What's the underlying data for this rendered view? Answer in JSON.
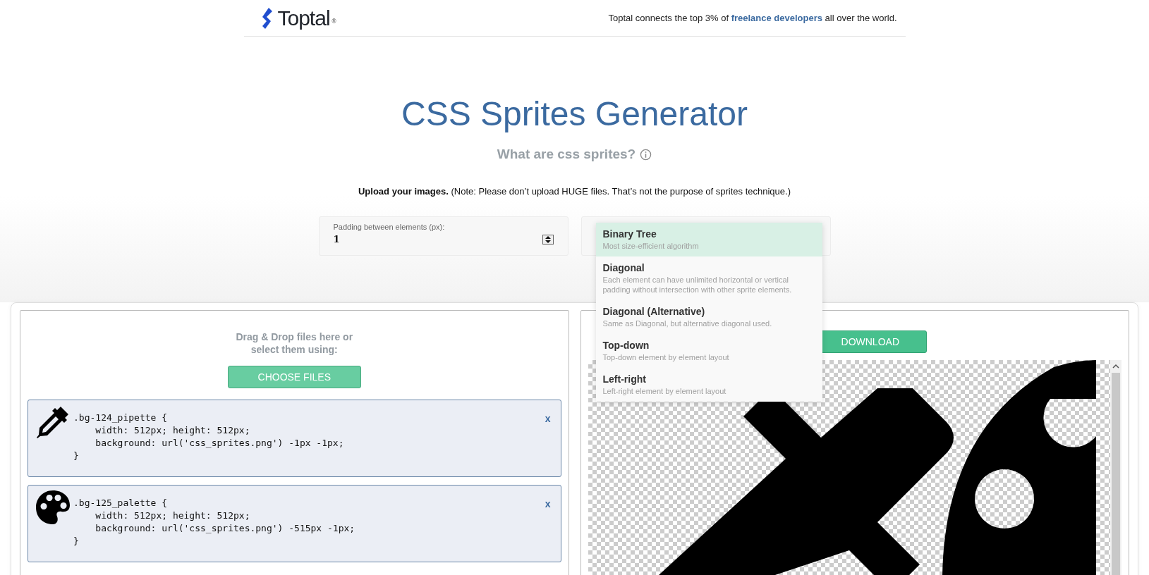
{
  "header": {
    "logo": "Toptal",
    "logo_mark": "®",
    "tagline_before": "Toptal connects the top 3% of",
    "tagline_link": "freelance developers",
    "tagline_after": "all over the world."
  },
  "title": "CSS Sprites Generator",
  "subtitle": "What are css sprites?",
  "upload_note": "**Upload your images.** (Note: Please don’t upload HUGE files. That’s not the purpose of sprites technique.)",
  "padding_option": {
    "label": "Padding between elements (px):",
    "value": "1"
  },
  "layout_dropdown": {
    "options": [
      {
        "title": "Binary Tree",
        "description": "Most size-efficient algorithm",
        "selected": true
      },
      {
        "title": "Diagonal",
        "description": "Each element can have unlimited horizontal or vertical padding without intersection with other sprite elements.",
        "selected": false
      },
      {
        "title": "Diagonal (Alternative)",
        "description": "Same as Diagonal, but alternative diagonal used.",
        "selected": false
      },
      {
        "title": "Top-down",
        "description": "Top-down element by element layout",
        "selected": false
      },
      {
        "title": "Left-right",
        "description": "Left-right element by element layout",
        "selected": false
      }
    ]
  },
  "upload": {
    "hint": "Drag & Drop files here or select them using:",
    "button": "CHOOSE FILES"
  },
  "sprites": [
    {
      "kind": "pipette",
      "code": ".bg-124_pipette {\n    width: 512px; height: 512px;\n    background: url('css_sprites.png') -1px -1px;\n}",
      "remove": "x"
    },
    {
      "kind": "palette",
      "code": ".bg-125_palette {\n    width: 512px; height: 512px;\n    background: url('css_sprites.png') -515px -1px;\n}",
      "remove": "x"
    }
  ],
  "download_button": "DOWNLOAD"
}
